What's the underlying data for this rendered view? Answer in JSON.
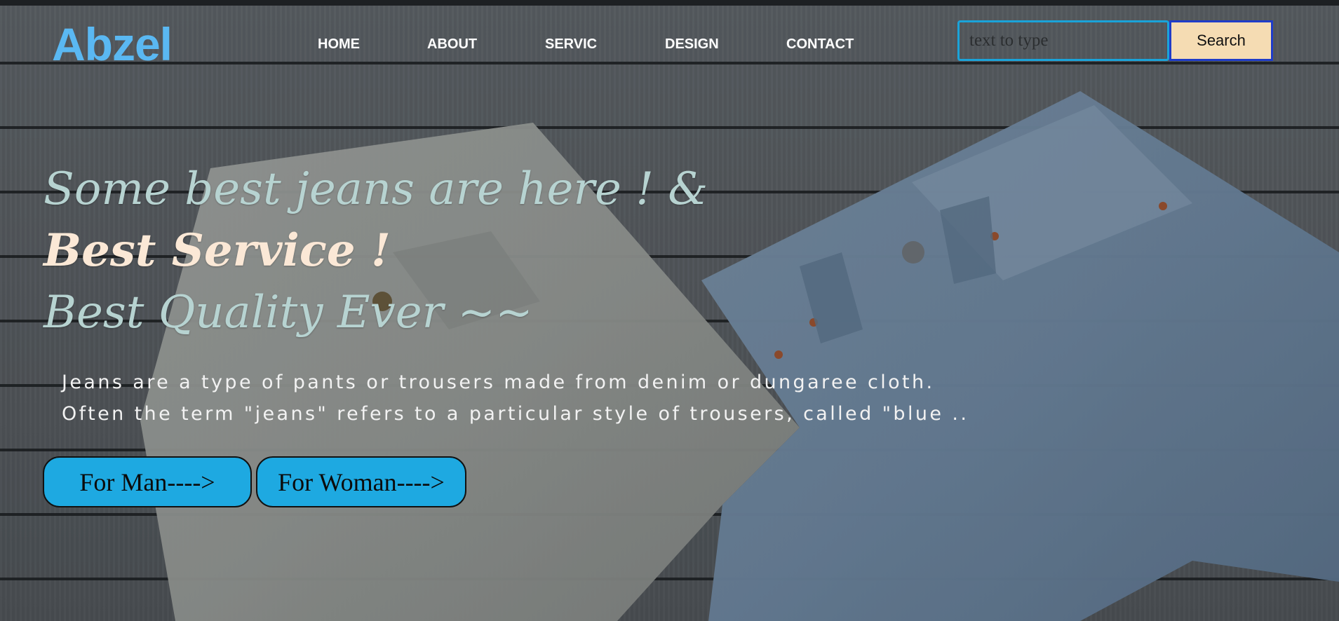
{
  "brand": {
    "logo_text": "Abzel",
    "logo_color": "#5ab8f2"
  },
  "nav": {
    "items": [
      {
        "label": "HOME"
      },
      {
        "label": "ABOUT"
      },
      {
        "label": "SERVIC"
      },
      {
        "label": "DESIGN"
      },
      {
        "label": "CONTACT"
      }
    ]
  },
  "search": {
    "placeholder": "text to type",
    "value": "",
    "button_label": "Search",
    "button_color": "#f5dcb3",
    "border_color": "#1aa3d9"
  },
  "hero": {
    "line1": "Some best jeans are here ! &",
    "line2": "Best Service !",
    "line3": "Best Quality Ever ~~",
    "description_line1": "Jeans are a type of pants or trousers made from denim or dungaree cloth.",
    "description_line2": "Often the term \"jeans\" refers to a particular style of trousers, called \"blue .."
  },
  "cta": {
    "man_label": "For Man---->",
    "woman_label": "For Woman---->",
    "button_color": "#1ea9e1"
  },
  "background": {
    "image_subject": "two pairs of denim shorts on grey wooden planks"
  }
}
